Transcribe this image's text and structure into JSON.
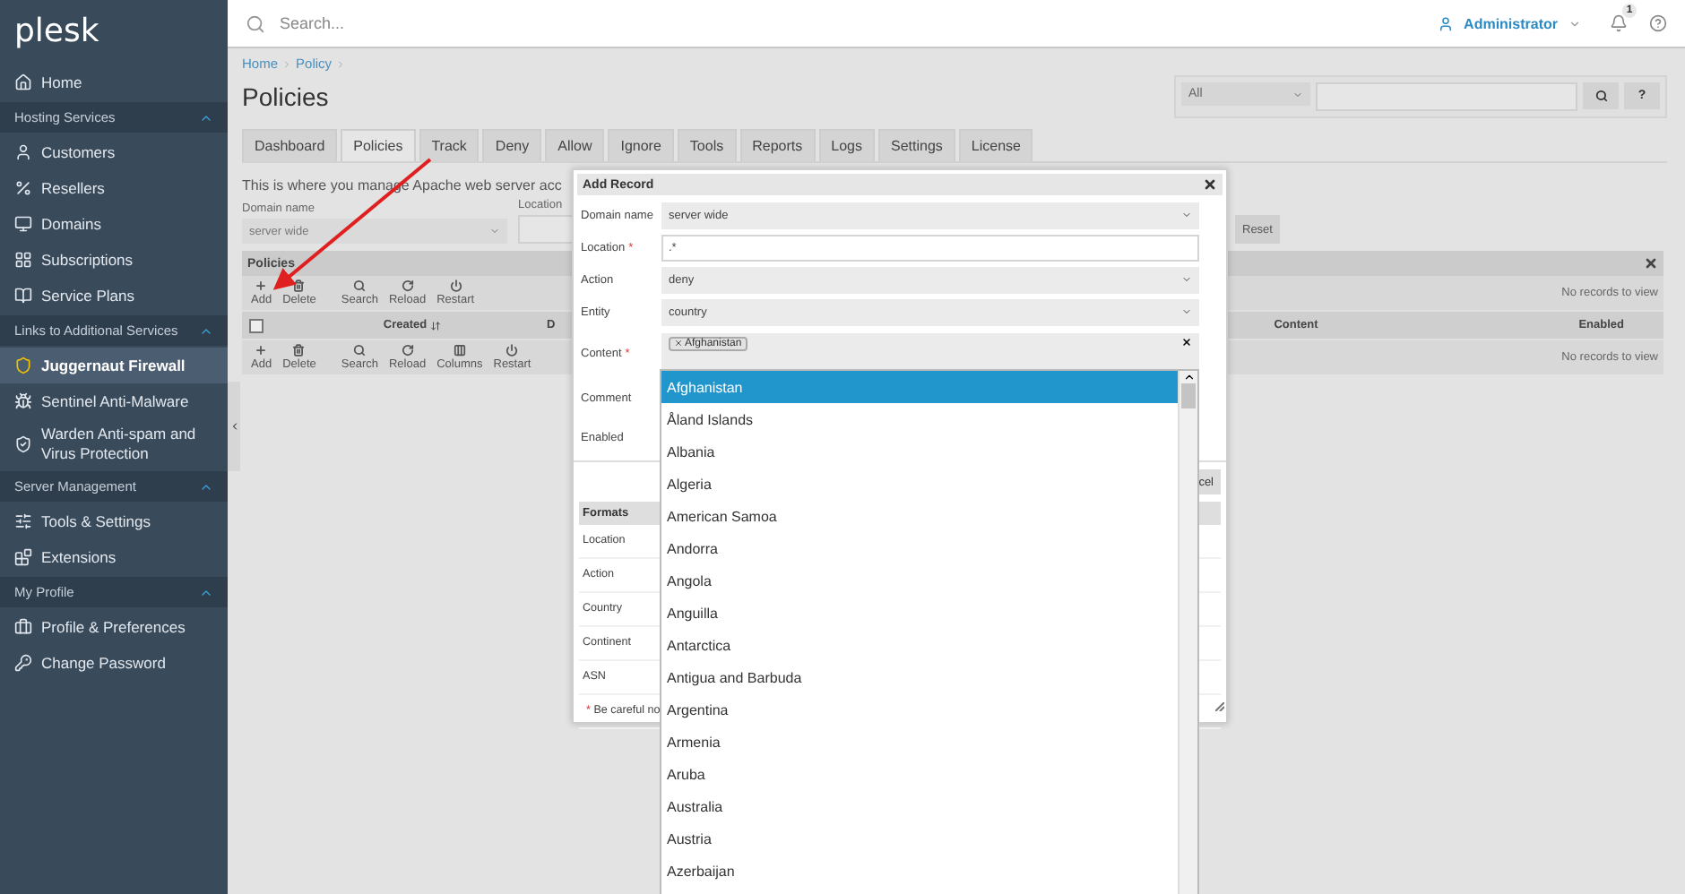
{
  "sidebar": {
    "logo": "plesk",
    "home": {
      "label": "Home",
      "selected": false
    },
    "sections": [
      {
        "title": "Hosting Services",
        "expanded": true,
        "items": [
          {
            "label": "Customers",
            "kind": "user",
            "selected": false
          },
          {
            "label": "Resellers",
            "kind": "percent",
            "selected": false
          },
          {
            "label": "Domains",
            "kind": "monitor",
            "selected": false
          },
          {
            "label": "Subscriptions",
            "kind": "grid",
            "selected": false
          },
          {
            "label": "Service Plans",
            "kind": "book",
            "selected": false
          }
        ]
      },
      {
        "title": "Links to Additional Services",
        "expanded": true,
        "items": [
          {
            "label": "Juggernaut Firewall",
            "kind": "shield",
            "selected": true
          },
          {
            "label": "Sentinel Anti-Malware",
            "kind": "bug",
            "selected": false
          },
          {
            "label": "Warden Anti-spam and Virus Protection",
            "kind": "shieldcheck",
            "selected": false
          }
        ]
      },
      {
        "title": "Server Management",
        "expanded": true,
        "items": [
          {
            "label": "Tools & Settings",
            "kind": "sliders",
            "selected": false
          },
          {
            "label": "Extensions",
            "kind": "blocks",
            "selected": false
          }
        ]
      },
      {
        "title": "My Profile",
        "expanded": true,
        "items": [
          {
            "label": "Profile & Preferences",
            "kind": "briefcase",
            "selected": false
          },
          {
            "label": "Change Password",
            "kind": "key",
            "selected": false
          }
        ]
      }
    ]
  },
  "topbar": {
    "search": {
      "placeholder": "Search..."
    },
    "user": "Administrator",
    "notifications": "1"
  },
  "breadcrumb": [
    "Home",
    "Policy"
  ],
  "title": "Policies",
  "quick_search": {
    "scope": "All",
    "help": "?"
  },
  "tabs": [
    {
      "label": "Dashboard",
      "selected": false
    },
    {
      "label": "Policies",
      "selected": true
    },
    {
      "label": "Track",
      "selected": false
    },
    {
      "label": "Deny",
      "selected": false
    },
    {
      "label": "Allow",
      "selected": false
    },
    {
      "label": "Ignore",
      "selected": false
    },
    {
      "label": "Tools",
      "selected": false
    },
    {
      "label": "Reports",
      "selected": false
    },
    {
      "label": "Logs",
      "selected": false
    },
    {
      "label": "Settings",
      "selected": false
    },
    {
      "label": "License",
      "selected": false
    }
  ],
  "description": "This is where you manage Apache web server acc",
  "filters": {
    "domain_label": "Domain name",
    "domain_value": "server wide",
    "location_label": "Location",
    "reset": "Reset"
  },
  "grid": {
    "title": "Policies",
    "empty_message_top": "No records to view",
    "empty_message_bottom": "No records to view",
    "toolbar_top": [
      {
        "label": "Add",
        "kind": "add"
      },
      {
        "label": "Delete",
        "kind": "delete"
      },
      {
        "label": "Search",
        "kind": "search"
      },
      {
        "label": "Reload",
        "kind": "reload"
      },
      {
        "label": "Restart",
        "kind": "restart"
      }
    ],
    "select_all": {
      "checked": false
    },
    "columns": [
      "Created",
      "D",
      "Content",
      "Enabled"
    ],
    "toolbar_bottom": [
      {
        "label": "Add",
        "kind": "add"
      },
      {
        "label": "Delete",
        "kind": "delete"
      },
      {
        "label": "Search",
        "kind": "search"
      },
      {
        "label": "Reload",
        "kind": "reload"
      },
      {
        "label": "Columns",
        "kind": "columns"
      },
      {
        "label": "Restart",
        "kind": "restart"
      }
    ]
  },
  "dialog": {
    "title": "Add Record",
    "fields": [
      {
        "label": "Domain name",
        "kind": "select",
        "value": "server wide"
      },
      {
        "label": "Location",
        "marker": "*",
        "kind": "input",
        "value": ".*"
      },
      {
        "label": "Action",
        "kind": "select",
        "value": "deny"
      },
      {
        "label": "Entity",
        "kind": "select",
        "value": "country"
      },
      {
        "label": "Content",
        "marker": "*",
        "kind": "tags",
        "tags": [
          "Afghanistan"
        ]
      },
      {
        "label": "Comment",
        "kind": "label"
      },
      {
        "label": "Enabled",
        "kind": "label"
      }
    ],
    "button": "cel",
    "formats": {
      "title": "Formats",
      "rows": [
        "Location",
        "Action",
        "Country",
        "Continent",
        "ASN"
      ],
      "note_marker": "*",
      "note": "Be careful no"
    },
    "dropdown": [
      {
        "label": "Afghanistan",
        "selected": true
      },
      {
        "label": "Åland Islands",
        "selected": false
      },
      {
        "label": "Albania",
        "selected": false
      },
      {
        "label": "Algeria",
        "selected": false
      },
      {
        "label": "American Samoa",
        "selected": false
      },
      {
        "label": "Andorra",
        "selected": false
      },
      {
        "label": "Angola",
        "selected": false
      },
      {
        "label": "Anguilla",
        "selected": false
      },
      {
        "label": "Antarctica",
        "selected": false
      },
      {
        "label": "Antigua and Barbuda",
        "selected": false
      },
      {
        "label": "Argentina",
        "selected": false
      },
      {
        "label": "Armenia",
        "selected": false
      },
      {
        "label": "Aruba",
        "selected": false
      },
      {
        "label": "Australia",
        "selected": false
      },
      {
        "label": "Austria",
        "selected": false
      },
      {
        "label": "Azerbaijan",
        "selected": false
      }
    ]
  }
}
